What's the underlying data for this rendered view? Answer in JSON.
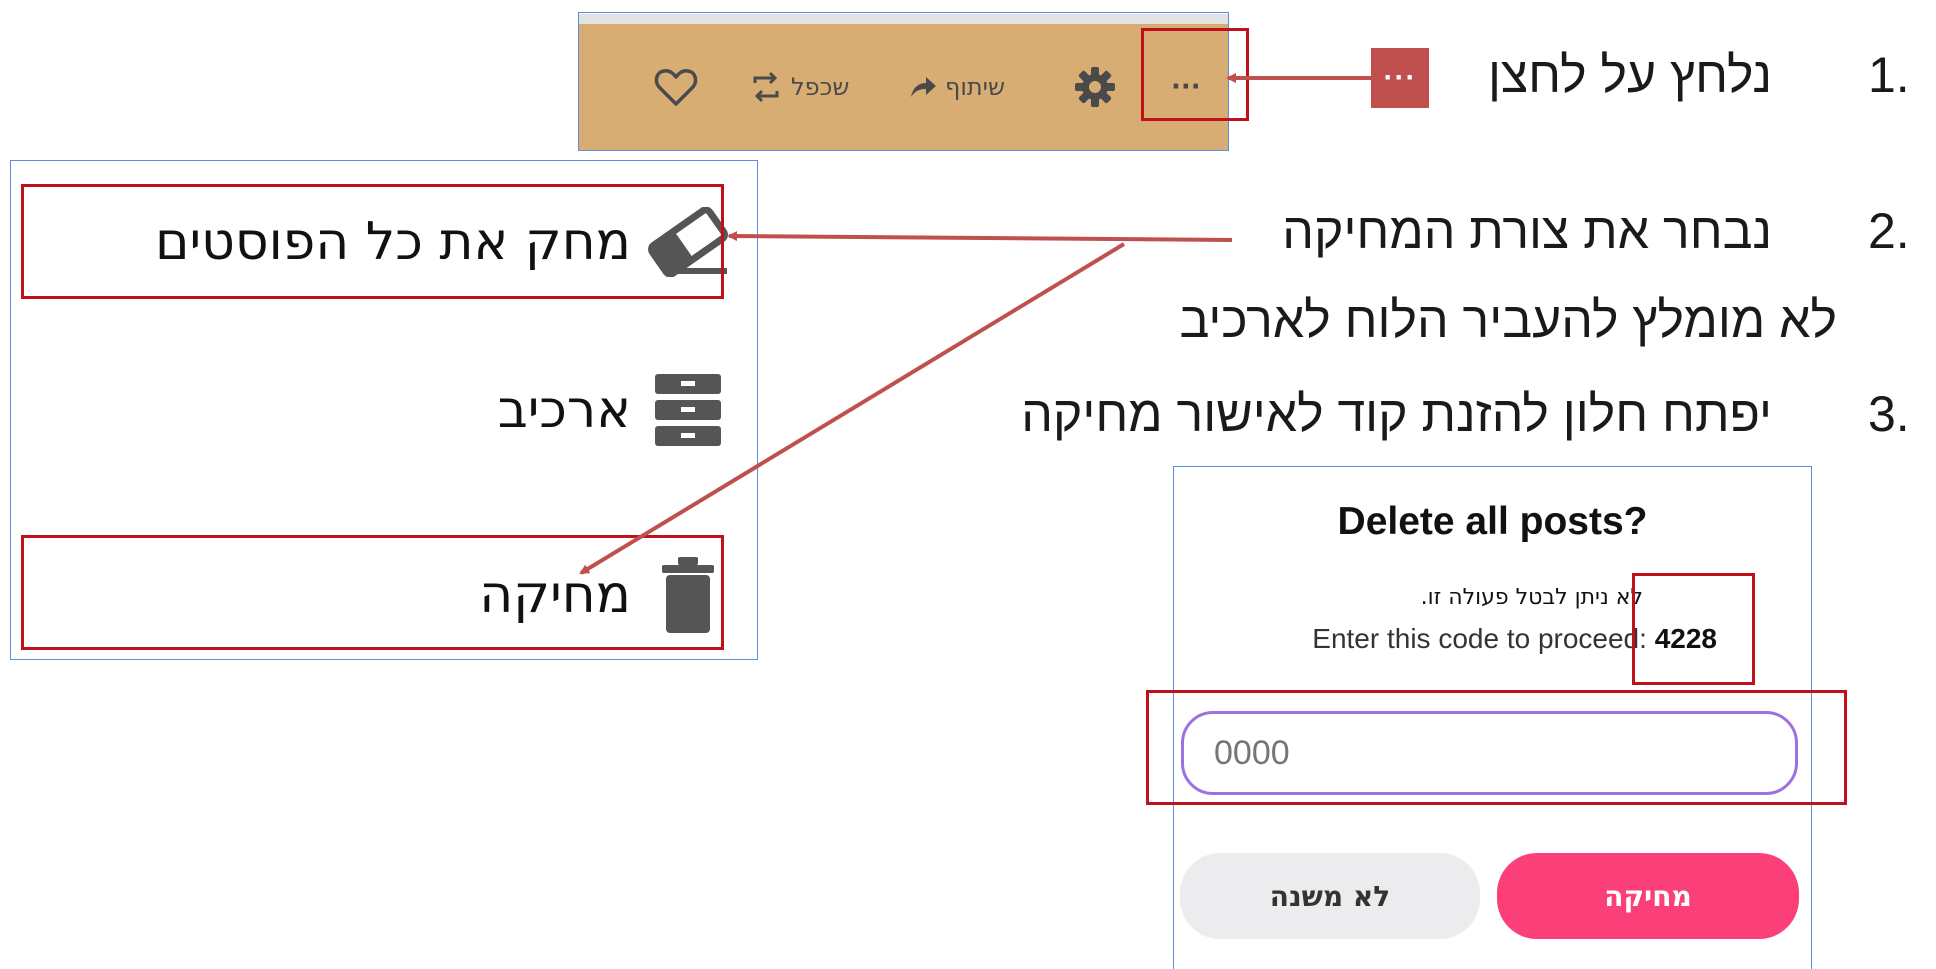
{
  "toolbar": {
    "duplicate_label": "שכפל",
    "share_label": "שיתוף",
    "more_symbol": "···",
    "icons": [
      "heart-icon",
      "repost-icon",
      "share-arrow-icon",
      "gear-icon",
      "ellipsis-icon"
    ],
    "background_color": "#d7ad74"
  },
  "steps": [
    {
      "number": "1.",
      "text": "נלחץ על לחצן"
    },
    {
      "number": "2.",
      "text": "נבחר את צורת המחיקה"
    },
    {
      "number": "",
      "text": "לא מומלץ להעביר הלוח לארכיב"
    },
    {
      "number": "3.",
      "text": "יפתח חלון להזנת קוד לאישור מחיקה"
    }
  ],
  "menu": {
    "items": [
      {
        "label": "מחק את כל הפוסטים",
        "icon": "eraser-icon"
      },
      {
        "label": "ארכיב",
        "icon": "archive-icon"
      },
      {
        "label": "מחיקה",
        "icon": "trash-icon"
      }
    ]
  },
  "dialog": {
    "title": "Delete all posts?",
    "warning": ".לא ניתן לבטל פעולה זו",
    "code_prompt": "Enter this code to proceed:",
    "code": "4228",
    "input_placeholder": "0000",
    "cancel_label": "לא משנה",
    "delete_label": "מחיקה"
  },
  "colors": {
    "highlight_red": "#c0101a",
    "arrow_red": "#c0504d",
    "delete_pink": "#fb3f78",
    "input_border": "#9b72e0",
    "frame_blue": "#5b8fd6"
  }
}
